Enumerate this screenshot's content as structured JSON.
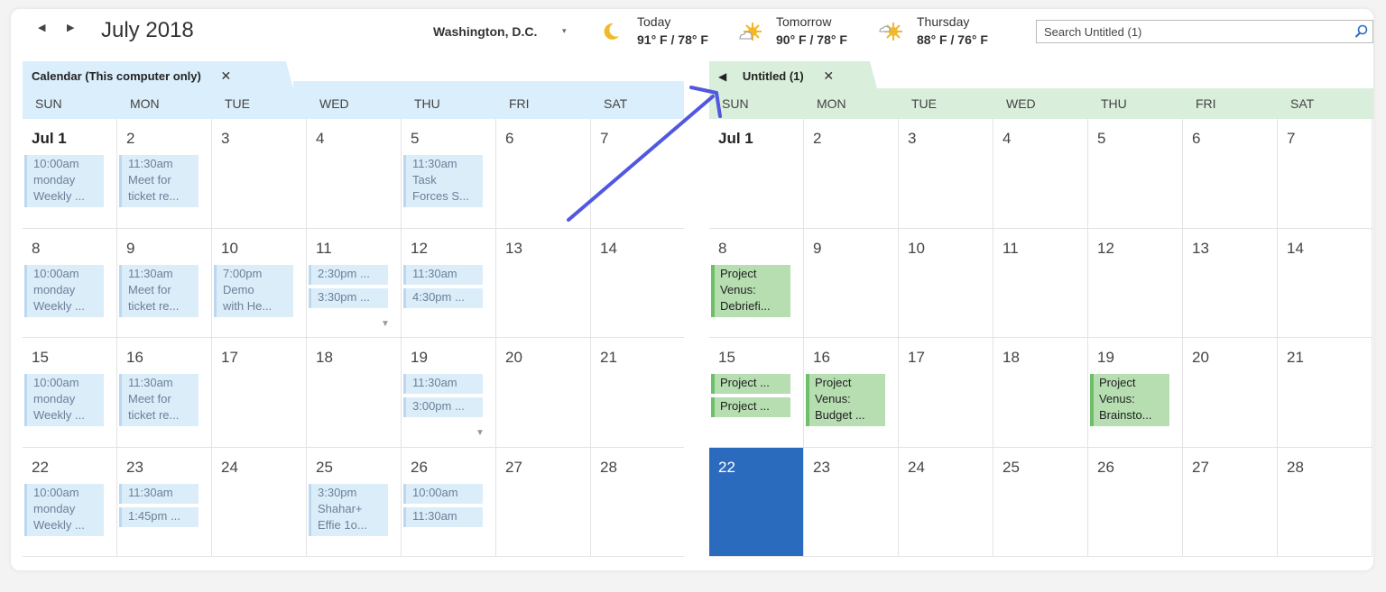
{
  "header": {
    "prev_label": "◀",
    "next_label": "▶",
    "month_title": "July 2018",
    "location": "Washington, D.C.",
    "location_caret": "▾",
    "weather": [
      {
        "day": "Today",
        "temp": "91° F / 78° F",
        "icon": "moon-icon"
      },
      {
        "day": "Tomorrow",
        "temp": "90° F / 78° F",
        "icon": "partly-sunny-icon"
      },
      {
        "day": "Thursday",
        "temp": "88° F / 76° F",
        "icon": "partly-sunny-icon"
      }
    ],
    "search_value": "Search Untitled (1)"
  },
  "left_pane": {
    "tab_label": "Calendar (This computer only)",
    "tab_close": "✕",
    "accent": "#dbeefb"
  },
  "right_pane": {
    "tab_back": "◀",
    "tab_label": "Untitled (1)",
    "tab_close": "✕",
    "accent": "#d9eedb"
  },
  "days_of_week": [
    "SUN",
    "MON",
    "TUE",
    "WED",
    "THU",
    "FRI",
    "SAT"
  ],
  "weeks": [
    [
      "Jul 1",
      "2",
      "3",
      "4",
      "5",
      "6",
      "7"
    ],
    [
      "8",
      "9",
      "10",
      "11",
      "12",
      "13",
      "14"
    ],
    [
      "15",
      "16",
      "17",
      "18",
      "19",
      "20",
      "21"
    ],
    [
      "22",
      "23",
      "24",
      "25",
      "26",
      "27",
      "28"
    ]
  ],
  "left_appointments": [
    {
      "week": 0,
      "day": 0,
      "slots": [
        "10:00am\nmonday\nWeekly ..."
      ]
    },
    {
      "week": 0,
      "day": 1,
      "slots": [
        "11:30am\nMeet for\nticket re..."
      ]
    },
    {
      "week": 0,
      "day": 4,
      "slots": [
        "11:30am\nTask\nForces S..."
      ]
    },
    {
      "week": 1,
      "day": 0,
      "slots": [
        "10:00am\nmonday\nWeekly ..."
      ]
    },
    {
      "week": 1,
      "day": 1,
      "slots": [
        "11:30am\nMeet for\nticket re..."
      ]
    },
    {
      "week": 1,
      "day": 2,
      "slots": [
        "7:00pm\nDemo\nwith He..."
      ]
    },
    {
      "week": 1,
      "day": 3,
      "slots": [
        "2:30pm ...",
        "3:30pm ..."
      ],
      "more": true
    },
    {
      "week": 1,
      "day": 4,
      "slots": [
        "11:30am",
        "4:30pm ..."
      ]
    },
    {
      "week": 2,
      "day": 0,
      "slots": [
        "10:00am\nmonday\nWeekly ..."
      ]
    },
    {
      "week": 2,
      "day": 1,
      "slots": [
        "11:30am\nMeet for\nticket re..."
      ]
    },
    {
      "week": 2,
      "day": 4,
      "slots": [
        "11:30am",
        "3:00pm ..."
      ],
      "more": true
    },
    {
      "week": 3,
      "day": 0,
      "slots": [
        "10:00am\nmonday\nWeekly ..."
      ]
    },
    {
      "week": 3,
      "day": 1,
      "slots": [
        "11:30am",
        "1:45pm ..."
      ]
    },
    {
      "week": 3,
      "day": 3,
      "slots": [
        "3:30pm\nShahar+\nEffie 1o..."
      ]
    },
    {
      "week": 3,
      "day": 4,
      "slots": [
        "10:00am",
        "11:30am"
      ]
    }
  ],
  "right_appointments": [
    {
      "week": 1,
      "day": 0,
      "slots": [
        "Project\nVenus:\nDebriefi..."
      ]
    },
    {
      "week": 2,
      "day": 0,
      "slots": [
        "Project ...",
        "Project ..."
      ]
    },
    {
      "week": 2,
      "day": 1,
      "slots": [
        "Project\nVenus:\nBudget ..."
      ]
    },
    {
      "week": 2,
      "day": 4,
      "slots": [
        "Project\nVenus:\nBrainsto..."
      ]
    }
  ],
  "right_today": {
    "week": 3,
    "day": 0,
    "color": "#2b6bbd"
  },
  "annotation": {
    "color": "#5157e0",
    "icon": "annotation-arrow"
  }
}
